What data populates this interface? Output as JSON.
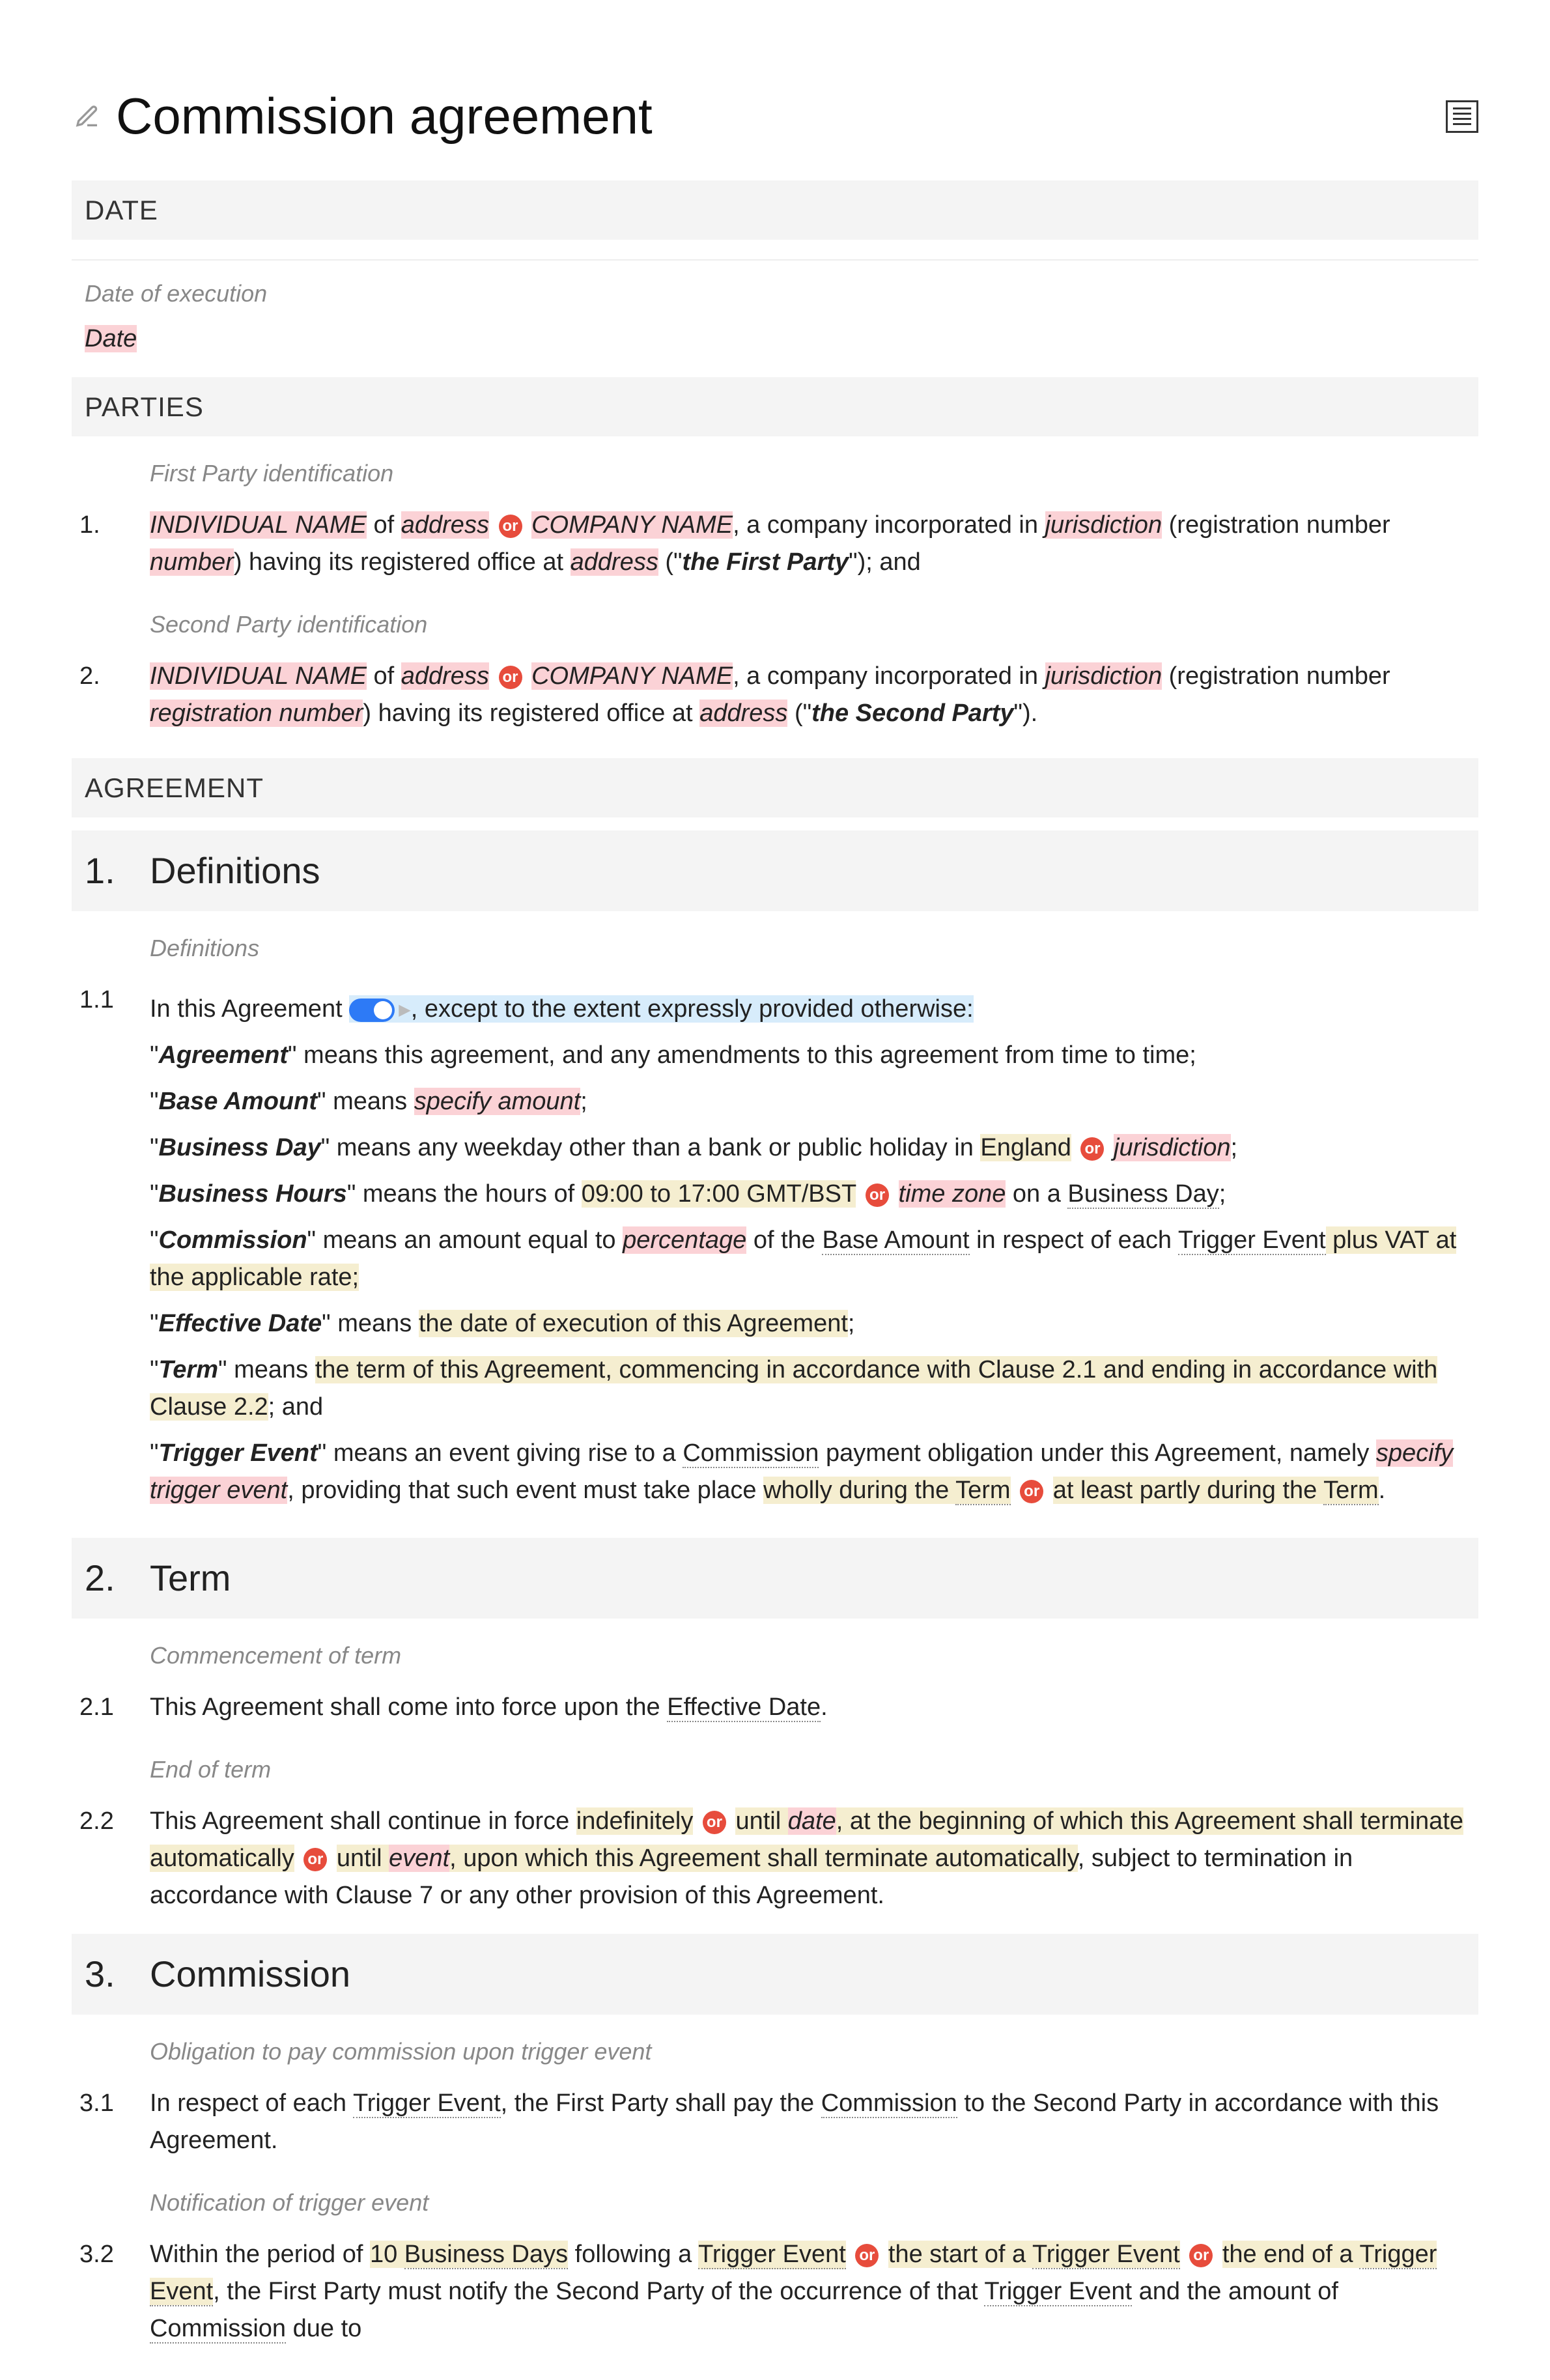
{
  "title": "Commission agreement",
  "headers": {
    "date": "DATE",
    "parties": "PARTIES",
    "agreement": "AGREEMENT"
  },
  "date": {
    "hint": "Date of execution",
    "value": "Date"
  },
  "parties": {
    "first_hint": "First Party identification",
    "second_hint": "Second Party identification",
    "n1": "1.",
    "n2": "2.",
    "indiv_name": "INDIVIDUAL NAME",
    "of": " of ",
    "address": "address",
    "or": "or",
    "company_name": " COMPANY NAME",
    "company_text": ", a company incorporated in ",
    "jurisdiction": "jurisdiction",
    "reg_open": " (registration number ",
    "number": "number",
    "reg_number": "registration number",
    "reg_close": ") having its registered office at ",
    "first_party": "the First Party",
    "second_party": "the Second Party",
    "and": "\"); and",
    "end": "\")."
  },
  "s1": {
    "num": "1.",
    "title": "Definitions",
    "hint": "Definitions",
    "c11": "1.1",
    "intro_a": "In this Agreement",
    "intro_b": ", except to the extent expressly provided otherwise:",
    "agreement_def": "\" means this agreement, and any amendments to this agreement from time to time;",
    "base_def_a": "\" means ",
    "specify_amount": "specify amount",
    "bd_def_a": "\" means any weekday other than a bank or public holiday in ",
    "england": "England",
    "bh_def_a": "\" means the hours of ",
    "hours": "09:00 to 17:00 GMT/BST",
    "time_zone": "time zone",
    "on_a": " on a ",
    "bday": "Business Day",
    "comm_def_a": "\" means an amount equal to ",
    "percentage": "percentage",
    "comm_def_b": " of the ",
    "base_amount": "Base Amount",
    "comm_def_c": " in respect of each ",
    "trigger_event": "Trigger Event",
    "comm_def_d": " plus VAT at the applicable rate;",
    "eff_def_a": "\" means ",
    "eff_def_b": "the date of execution of this Agreement",
    "term_def_a": "\" means ",
    "term_def_b": "the term of this Agreement, commencing in accordance with Clause 2.1 and ending in accordance with Clause 2.2",
    "term_def_c": "; and",
    "te_def_a": "\" means an event giving rise to a ",
    "commission": "Commission",
    "te_def_b": " payment obligation under this Agreement, namely ",
    "specify_trigger": "specify trigger event",
    "te_def_c": ", providing that such event must take place ",
    "wholly": "wholly during the ",
    "partly": "at least partly during the ",
    "term_word": "Term",
    "period": ".",
    "semicolon": ";",
    "terms": {
      "agreement": "Agreement",
      "base_amount": "Base Amount",
      "business_day": "Business Day",
      "business_hours": "Business Hours",
      "commission": "Commission",
      "effective_date": "Effective Date",
      "term": "Term",
      "trigger_event": "Trigger Event"
    }
  },
  "s2": {
    "num": "2.",
    "title": "Term",
    "hint1": "Commencement of term",
    "c21": "2.1",
    "c21_a": "This Agreement shall come into force upon the ",
    "eff_date": "Effective Date",
    "hint2": "End of term",
    "c22": "2.2",
    "c22_a": "This Agreement shall continue in force ",
    "indef": "indefinitely",
    "until": " until ",
    "date": "date",
    "c22_b": ", at the beginning of which this Agreement shall terminate automatically",
    "event": "event",
    "c22_c": ", upon which this Agreement shall terminate automatically",
    "c22_d": ", subject to termination in accordance with Clause 7 or any other provision of this Agreement."
  },
  "s3": {
    "num": "3.",
    "title": "Commission",
    "hint1": "Obligation to pay commission upon trigger event",
    "c31": "3.1",
    "c31_a": "In respect of each ",
    "trigger_event": "Trigger Event",
    "c31_b": ", the First Party shall pay the ",
    "commission": "Commission",
    "c31_c": " to the Second Party in accordance with this Agreement.",
    "hint2": "Notification of trigger event",
    "c32": "3.2",
    "c32_a": "Within the period of ",
    "ten_bd": "10 ",
    "bds": "Business Days",
    "c32_b": " following a ",
    "c32_c": "the start of a ",
    "c32_d": "the end of a ",
    "c32_e": ", the First Party must notify the Second Party of the occurrence of that ",
    "c32_f": " and the amount of ",
    "c32_g": " due to"
  },
  "q": "\"",
  "open_paren_q": " (\""
}
